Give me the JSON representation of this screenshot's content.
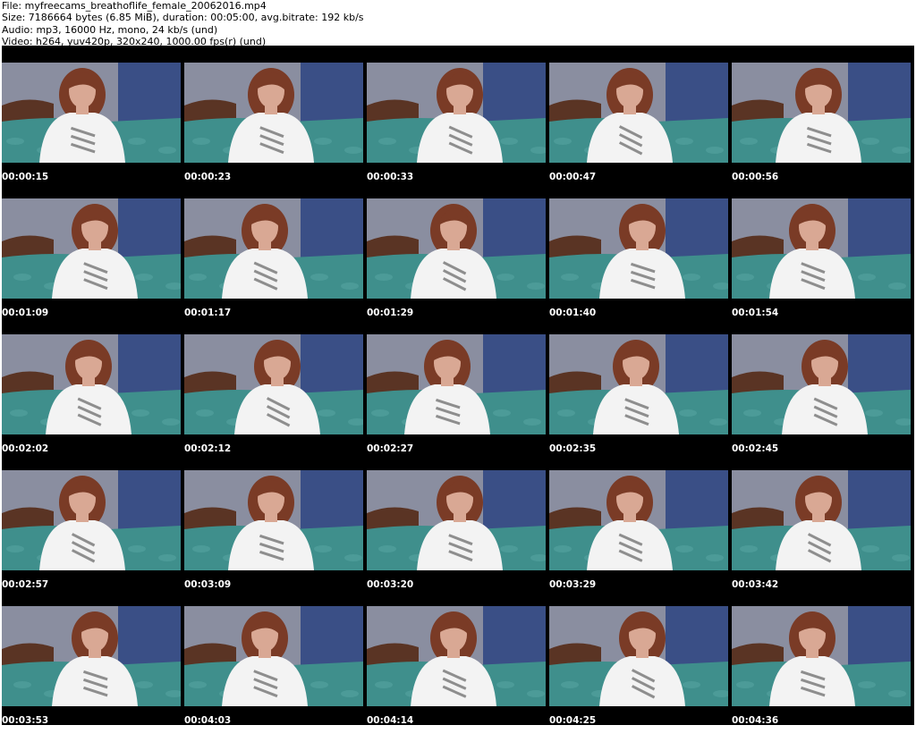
{
  "header": {
    "file": "File: myfreecams_breathoflife_female_20062016.mp4",
    "size": "Size: 7186664 bytes (6.85 MiB), duration: 00:05:00, avg.bitrate: 192 kb/s",
    "audio": "Audio: mp3, 16000 Hz, mono, 24 kb/s (und)",
    "video": "Video: h264, yuv420p, 320x240, 1000.00 fps(r) (und)"
  },
  "thumbnails": [
    [
      "00:00:15",
      "00:00:23",
      "00:00:33",
      "00:00:47",
      "00:00:56"
    ],
    [
      "00:01:09",
      "00:01:17",
      "00:01:29",
      "00:01:40",
      "00:01:54"
    ],
    [
      "00:02:02",
      "00:02:12",
      "00:02:27",
      "00:02:35",
      "00:02:45"
    ],
    [
      "00:02:57",
      "00:03:09",
      "00:03:20",
      "00:03:29",
      "00:03:42"
    ],
    [
      "00:03:53",
      "00:04:03",
      "00:04:14",
      "00:04:25",
      "00:04:36"
    ]
  ],
  "colors": {
    "sheet_background": "#000000",
    "wall": "#8a8ea0",
    "curtain": "#3a4f86",
    "bedspread": "#3f8f8c",
    "headboard": "#5a3424",
    "shirt": "#f3f3f3",
    "hair": "#7a3b26",
    "skin": "#d9a894",
    "timestamp": "#ffffff"
  }
}
